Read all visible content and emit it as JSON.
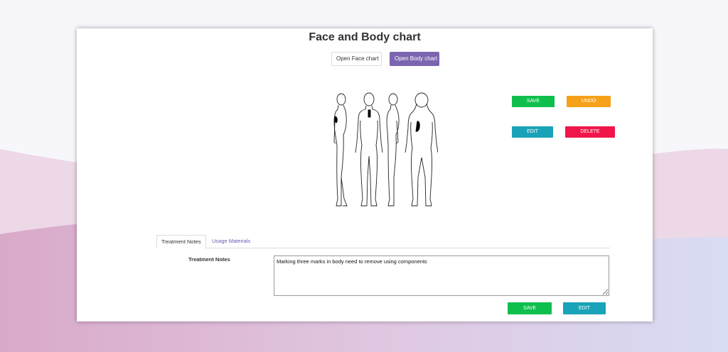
{
  "title": "Face and Body chart",
  "chart_buttons": {
    "face": "Open Face chart",
    "body": "Open Body chart"
  },
  "actions": {
    "save": "SAVE",
    "undo": "UNDO",
    "edit": "EDIT",
    "delete": "DELETE"
  },
  "tabs": [
    {
      "label": "Treatment Notes",
      "active": true
    },
    {
      "label": "Usage Materials",
      "active": false
    }
  ],
  "notes": {
    "label": "Treatment Notes",
    "value": "Marking three marks in body need to remove using components"
  },
  "notes_actions": {
    "save": "SAVE",
    "edit": "EDIT"
  },
  "colors": {
    "accent_purple": "#7b65b0",
    "save_green": "#0fbf4d",
    "undo_orange": "#f6a11a",
    "edit_teal": "#19a3b8",
    "delete_red": "#f0164a"
  }
}
